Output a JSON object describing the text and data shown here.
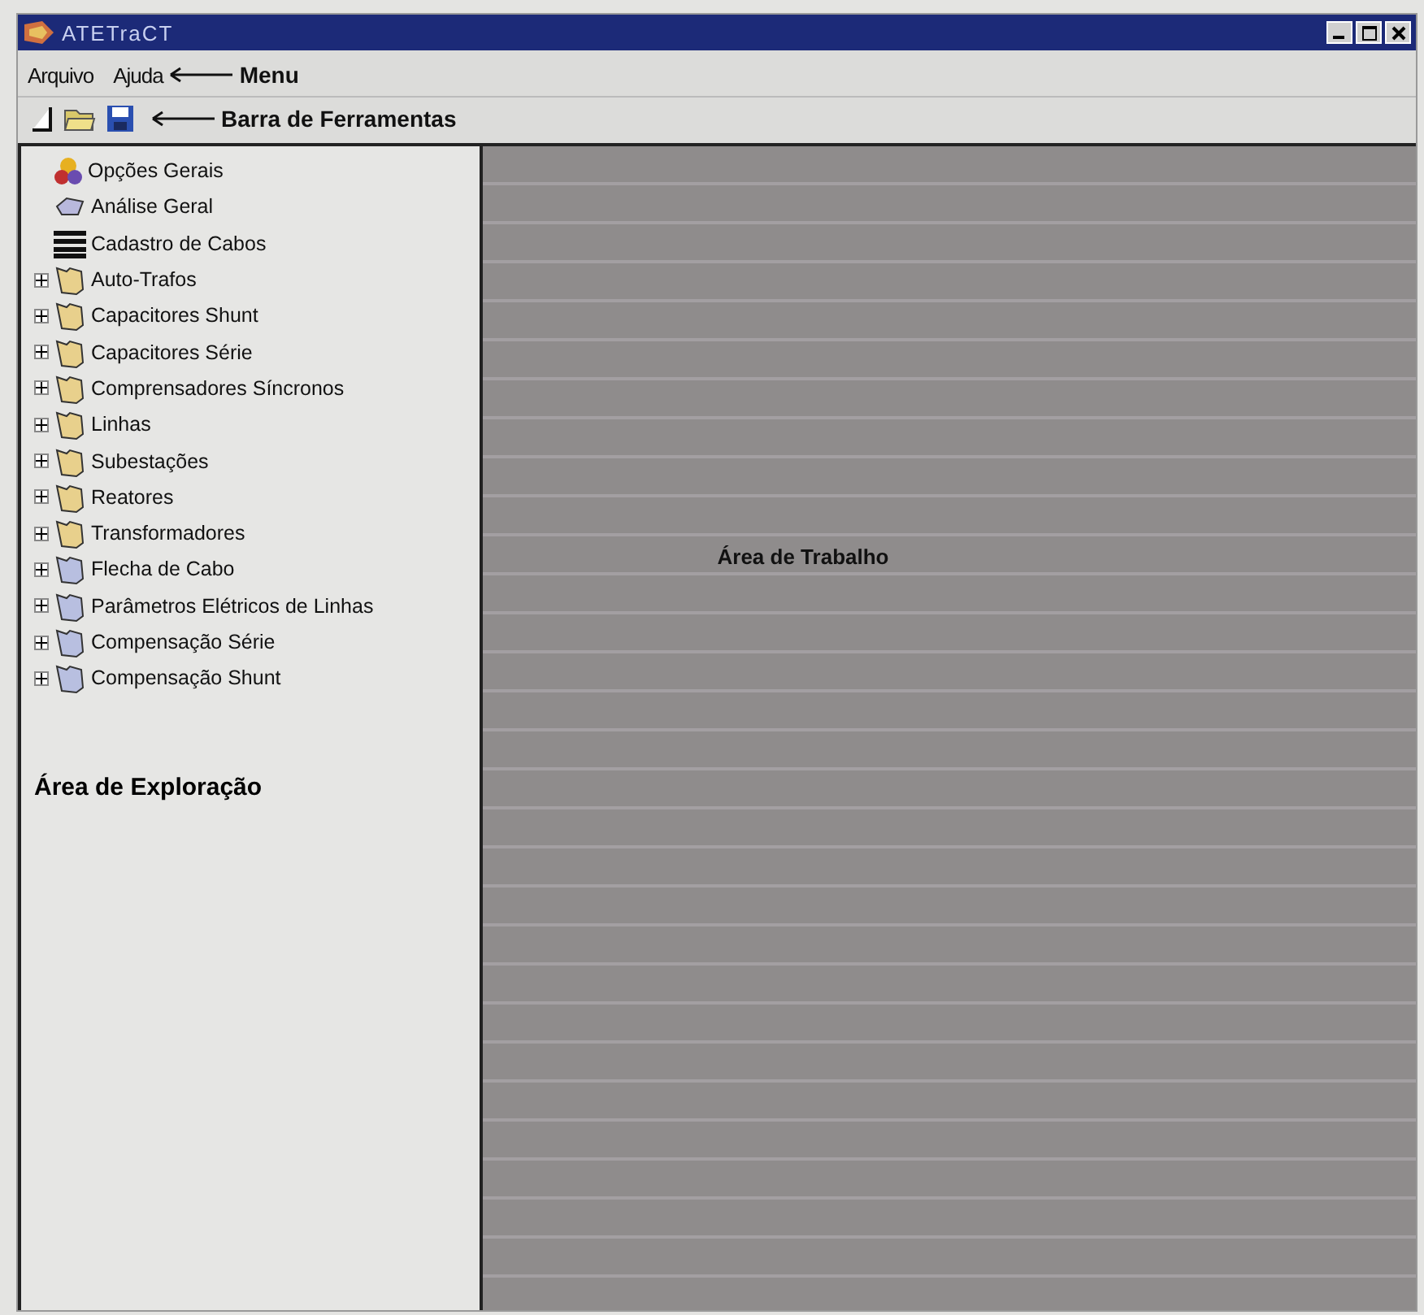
{
  "window": {
    "title": "ATETraCT"
  },
  "menu": {
    "items": [
      "Arquivo",
      "Ajuda"
    ],
    "annotation": "Menu"
  },
  "toolbar": {
    "buttons": [
      {
        "kind": "new"
      },
      {
        "kind": "open"
      },
      {
        "kind": "save"
      }
    ],
    "annotation": "Barra de Ferramentas"
  },
  "explorer": {
    "items": [
      {
        "kind": "options",
        "label": "Opções Gerais"
      },
      {
        "kind": "analysis",
        "label": "Análise Geral"
      },
      {
        "kind": "list",
        "label": "Cadastro de Cabos"
      },
      {
        "kind": "folder",
        "label": "Auto-Trafos",
        "color": "#e8d08c",
        "expanded": false
      },
      {
        "kind": "folder",
        "label": "Capacitores Shunt",
        "color": "#e8d08c",
        "expanded": false
      },
      {
        "kind": "folder",
        "label": "Capacitores Série",
        "color": "#e8d08c",
        "expanded": false
      },
      {
        "kind": "folder",
        "label": "Comprensadores Síncronos",
        "color": "#e8d08c",
        "expanded": false
      },
      {
        "kind": "folder",
        "label": "Linhas",
        "color": "#e8d08c",
        "expanded": false
      },
      {
        "kind": "folder",
        "label": "Subestações",
        "color": "#e8d08c",
        "expanded": false
      },
      {
        "kind": "folder",
        "label": "Reatores",
        "color": "#e8d08c",
        "expanded": false
      },
      {
        "kind": "folder",
        "label": "Transformadores",
        "color": "#e8d08c",
        "expanded": false
      },
      {
        "kind": "folder",
        "label": "Flecha de Cabo",
        "color": "#b8bfe0",
        "expanded": false
      },
      {
        "kind": "folder",
        "label": "Parâmetros Elétricos de Linhas",
        "color": "#b8bfe0",
        "expanded": false
      },
      {
        "kind": "folder",
        "label": "Compensação Série",
        "color": "#b8bfe0",
        "expanded": false
      },
      {
        "kind": "folder",
        "label": "Compensação Shunt",
        "color": "#b8bfe0",
        "expanded": false
      }
    ],
    "annotation": "Área de Exploração"
  },
  "workspace": {
    "annotation": "Área de Trabalho"
  }
}
